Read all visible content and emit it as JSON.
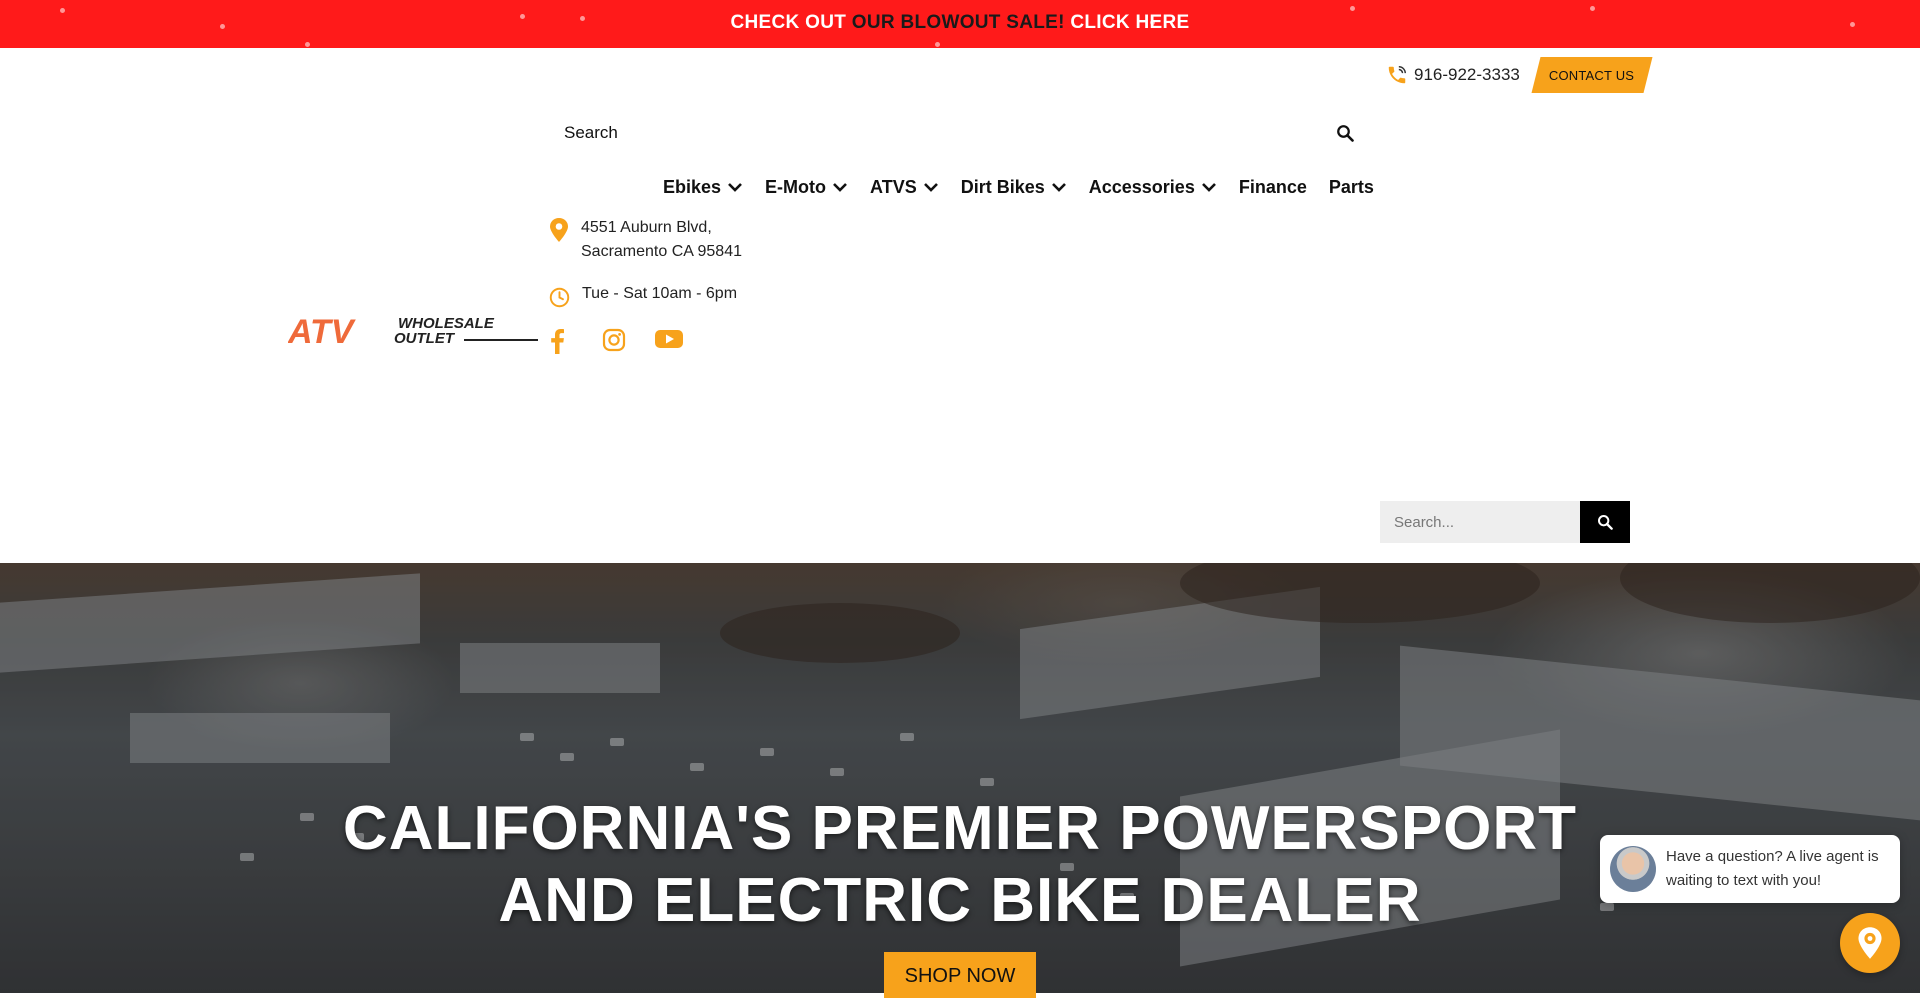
{
  "promo": {
    "part1": "CHECK OUT ",
    "part2": "OUR BLOWOUT SALE!",
    "part3": " CLICK HERE"
  },
  "header": {
    "phone": "916-922-3333",
    "contact_label": "CONTACT US"
  },
  "search": {
    "placeholder": "Search"
  },
  "nav": {
    "items": [
      {
        "label": "Ebikes",
        "has_dropdown": true
      },
      {
        "label": "E-Moto",
        "has_dropdown": true
      },
      {
        "label": "ATVS",
        "has_dropdown": true
      },
      {
        "label": "Dirt Bikes",
        "has_dropdown": true
      },
      {
        "label": "Accessories",
        "has_dropdown": true
      },
      {
        "label": "Finance",
        "has_dropdown": false
      },
      {
        "label": "Parts",
        "has_dropdown": false
      }
    ]
  },
  "logo": {
    "text_main": "ATV",
    "text_top": "WHOLESALE",
    "text_bottom": "OUTLET"
  },
  "info": {
    "address_line1": "4551 Auburn Blvd,",
    "address_line2": "Sacramento CA 95841",
    "hours": "Tue - Sat 10am - 6pm"
  },
  "social": {
    "icons": [
      "facebook-icon",
      "instagram-icon",
      "youtube-icon"
    ]
  },
  "secondary_search": {
    "placeholder": "Search..."
  },
  "hero": {
    "title_line1": "CALIFORNIA'S PREMIER POWERSPORT",
    "title_line2": "AND ELECTRIC BIKE DEALER",
    "button_label": "SHOP NOW"
  },
  "chat": {
    "message": "Have a question? A live agent is waiting to text with you!"
  },
  "colors": {
    "promo_red": "#ff1a1a",
    "accent_orange": "#f7a21b",
    "black": "#000000"
  }
}
